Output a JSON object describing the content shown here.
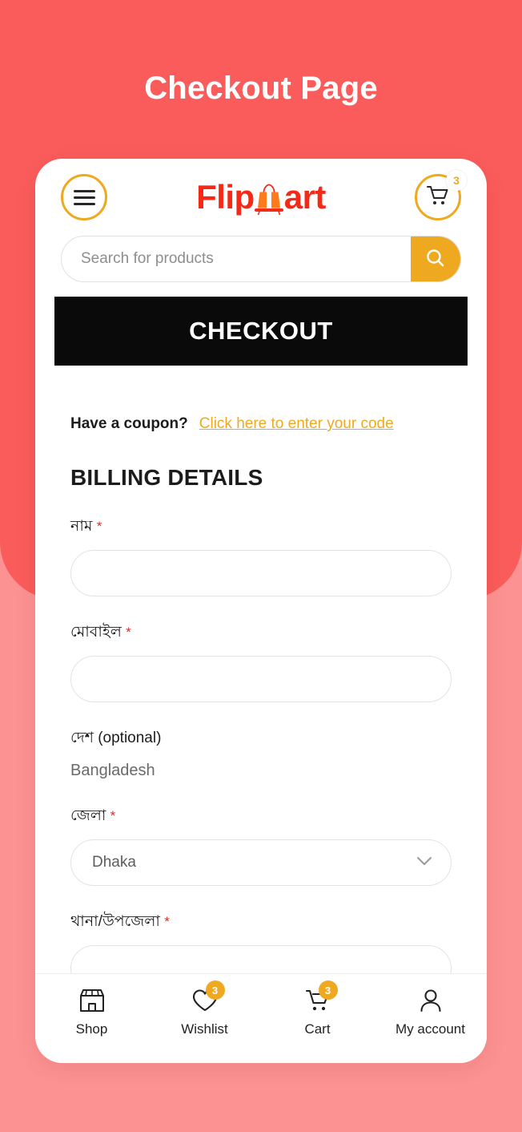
{
  "page": {
    "title": "Checkout Page",
    "background_top_color": "#FA5C5C",
    "background_bottom_color": "#FC9292"
  },
  "header": {
    "menu_icon": "hamburger-menu-icon",
    "logo": {
      "text_before": "Flip",
      "text_after": "art",
      "bag_icon": "shopping-bag-icon",
      "color": "#F42A16"
    },
    "cart_icon": "shopping-cart-icon",
    "cart_badge": "3",
    "accent_color": "#EFA920"
  },
  "search": {
    "placeholder": "Search for products",
    "value": "",
    "button_icon": "search-icon"
  },
  "banner": {
    "title": "CHECKOUT"
  },
  "coupon": {
    "label": "Have a coupon?",
    "link": "Click here to enter your code"
  },
  "billing": {
    "section_title": "BILLING DETAILS",
    "fields": [
      {
        "label": "নাম",
        "required": "*",
        "type": "text",
        "value": "",
        "placeholder": ""
      },
      {
        "label": "মোবাইল",
        "required": "*",
        "type": "text",
        "value": "",
        "placeholder": ""
      },
      {
        "label": "দেশ (optional)",
        "required": "",
        "type": "static",
        "value": "Bangladesh"
      },
      {
        "label": "জেলা",
        "required": "*",
        "type": "select",
        "value": "Dhaka",
        "icon": "chevron-down-icon"
      },
      {
        "label": "থানা/উপজেলা",
        "required": "*",
        "type": "text",
        "value": "",
        "placeholder": ""
      }
    ]
  },
  "bottom_nav": {
    "items": [
      {
        "label": "Shop",
        "icon": "store-icon",
        "badge": ""
      },
      {
        "label": "Wishlist",
        "icon": "heart-icon",
        "badge": "3"
      },
      {
        "label": "Cart",
        "icon": "cart-icon",
        "badge": "3"
      },
      {
        "label": "My account",
        "icon": "user-icon",
        "badge": ""
      }
    ]
  }
}
